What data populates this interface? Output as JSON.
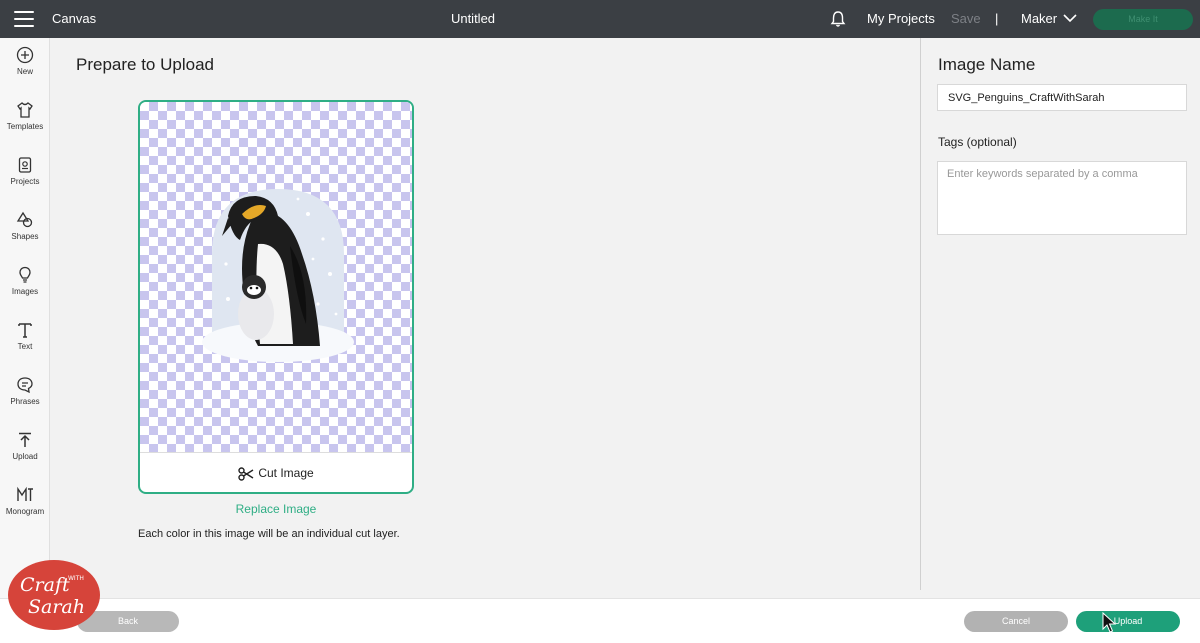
{
  "topbar": {
    "app_title": "Canvas",
    "doc_title": "Untitled",
    "my_projects": "My Projects",
    "save": "Save",
    "separator": "|",
    "machine": "Maker",
    "make_it": "Make It"
  },
  "rail": {
    "items": [
      {
        "label": "New",
        "icon": "plus-circle-icon"
      },
      {
        "label": "Templates",
        "icon": "tshirt-icon"
      },
      {
        "label": "Projects",
        "icon": "projects-icon"
      },
      {
        "label": "Shapes",
        "icon": "shapes-icon"
      },
      {
        "label": "Images",
        "icon": "lightbulb-icon"
      },
      {
        "label": "Text",
        "icon": "text-t-icon"
      },
      {
        "label": "Phrases",
        "icon": "speech-bubble-icon"
      },
      {
        "label": "Upload",
        "icon": "upload-arrow-icon"
      },
      {
        "label": "Monogram",
        "icon": "monogram-icon"
      }
    ]
  },
  "main": {
    "title": "Prepare to Upload",
    "cut_image": "Cut Image",
    "replace_image": "Replace Image",
    "note": "Each color in this image will be an individual cut layer."
  },
  "right_panel": {
    "title": "Image Name",
    "image_name_value": "SVG_Penguins_CraftWithSarah",
    "tags_label": "Tags (optional)",
    "tags_placeholder": "Enter keywords separated by a comma"
  },
  "bottom": {
    "back": "Back",
    "cancel": "Cancel",
    "upload": "Upload"
  },
  "watermark": {
    "line1": "Craft",
    "line2": "WITH",
    "line3": "Sarah"
  },
  "colors": {
    "topbar": "#3b3f44",
    "accent_green": "#2fae85",
    "upload_green": "#1ea07a",
    "checker": "#c8c5ee"
  }
}
